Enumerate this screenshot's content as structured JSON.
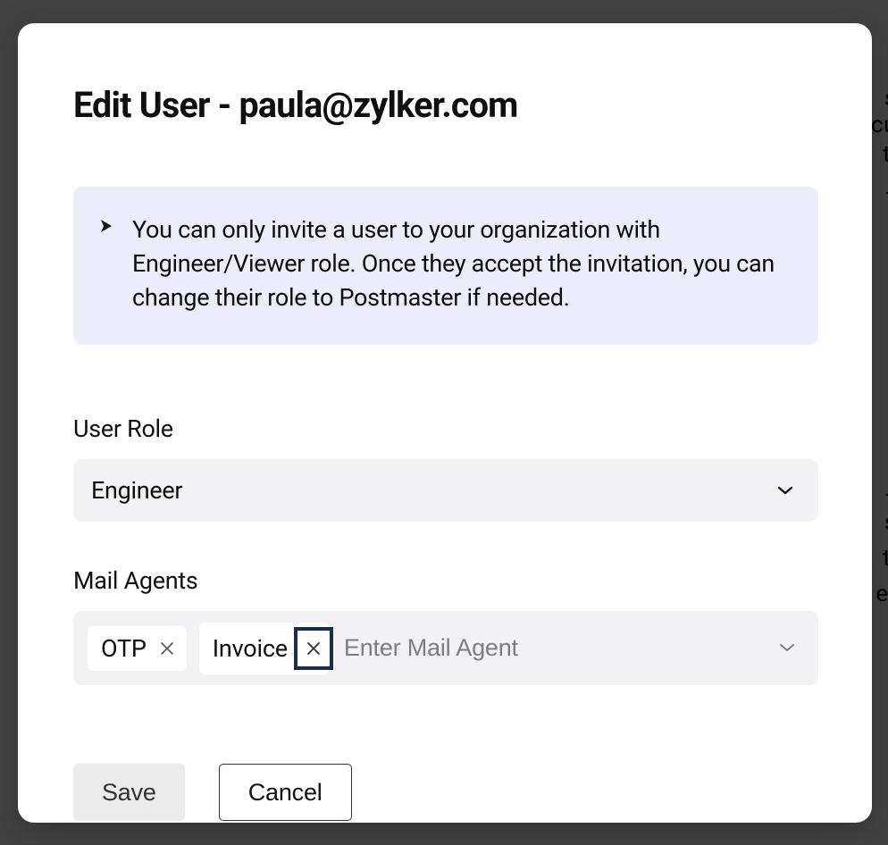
{
  "modal": {
    "title": "Edit User - paula@zylker.com"
  },
  "notice": {
    "text": "You can only invite a user to your organization with Engineer/Viewer role. Once they accept the invitation, you can change their role to Postmaster if needed."
  },
  "userRole": {
    "label": "User Role",
    "selected": "Engineer"
  },
  "mailAgents": {
    "label": "Mail Agents",
    "placeholder": "Enter Mail Agent",
    "tags": [
      {
        "label": "OTP"
      },
      {
        "label": "Invoice"
      }
    ]
  },
  "actions": {
    "save": "Save",
    "cancel": "Cancel"
  },
  "backgroundFragments": {
    "f1": "s",
    "f2": "cu",
    "f3": "ti",
    "f4": "_",
    "f5": "_",
    "f6": "s",
    "f7": "ti",
    "f8": "er"
  }
}
